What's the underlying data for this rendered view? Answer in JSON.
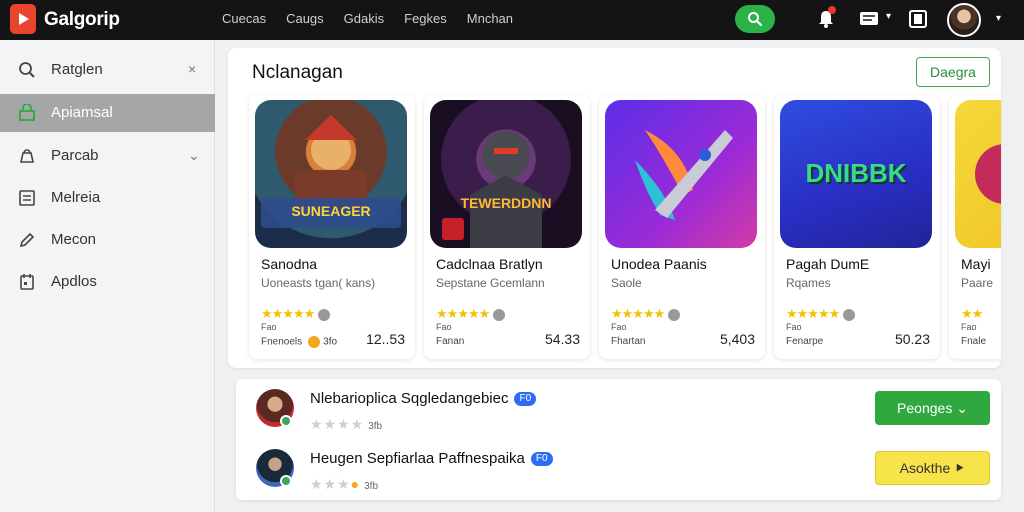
{
  "app": {
    "name": "Galgorip"
  },
  "topnav": [
    "Cuecas",
    "Caugs",
    "Gdakis",
    "Fegkes",
    "Mnchan"
  ],
  "header_icons": {
    "search": "search-icon",
    "alerts": "bell-icon",
    "messages": "chat-icon",
    "library": "stack-icon"
  },
  "sidebar": {
    "items": [
      {
        "label": "Ratglen",
        "icon": "search-icon",
        "trail": "×"
      },
      {
        "label": "Apiamsal",
        "icon": "store-icon",
        "active": true
      },
      {
        "label": "Parcab",
        "icon": "bag-icon",
        "trail": "⌄"
      },
      {
        "label": "Melreia",
        "icon": "library-icon"
      },
      {
        "label": "Mecon",
        "icon": "pencil-icon"
      },
      {
        "label": "Apdlos",
        "icon": "calendar-icon"
      }
    ]
  },
  "featured": {
    "title": "Nclanagan",
    "action": "Daegra",
    "games": [
      {
        "title": "Sanodna",
        "subtitle": "Uoneasts tgan( kans)",
        "small": "Fao",
        "meta": "Fnenoels",
        "meta2": "3fo",
        "price": "12..53",
        "art_text": "SUNEAGER"
      },
      {
        "title": "Cadclnaa Bratlyn",
        "subtitle": "Sepstane Gcemlann",
        "small": "Fao",
        "meta": "Fanan",
        "meta2": "",
        "price": "54.33",
        "art_text": "TEWERDDNN"
      },
      {
        "title": "Unodea Paanis",
        "subtitle": "Saole",
        "small": "Fao",
        "meta": "Fhartan",
        "meta2": "",
        "price": "5,403",
        "art_text": ""
      },
      {
        "title": "Pagah DumE",
        "subtitle": "Rqames",
        "small": "Fao",
        "meta": "Fenarpe",
        "meta2": "",
        "price": "50.23",
        "art_text": "DNIBBK"
      },
      {
        "title": "Mayi",
        "subtitle": "Paare",
        "small": "Fao",
        "meta": "Fnale",
        "meta2": "",
        "price": "",
        "art_text": ""
      }
    ]
  },
  "people": [
    {
      "name": "Nlebarioplica Sqgledangebiec",
      "tag": "F0",
      "count": "3fb",
      "button": "Peonges ⌄",
      "button_style": "green"
    },
    {
      "name": "Heugen Sepfiarlaa Paffnespaika",
      "tag": "F0",
      "count": "3fb",
      "button": "Asokthe ⯈",
      "button_style": "yellow"
    }
  ],
  "colors": {
    "topbar": "#141414",
    "accent_green": "#2fa83f",
    "accent_yellow": "#f7e34a",
    "brand_red": "#e8452c"
  }
}
